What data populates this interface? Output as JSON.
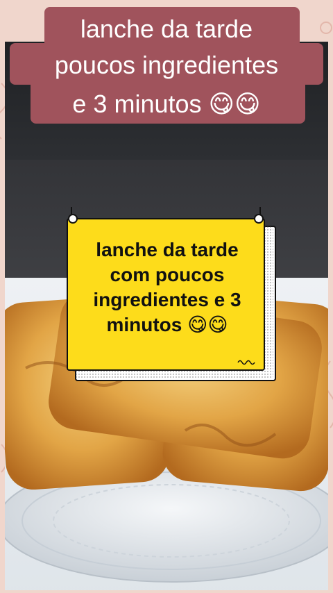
{
  "title": {
    "line1": "lanche da tarde",
    "line2": "poucos ingredientes",
    "line3": "e 3 minutos 😋😋"
  },
  "card": {
    "text": "lanche da tarde com poucos ingredientes e 3 minutos 😋😋"
  },
  "colors": {
    "title_bg": "#a0535c",
    "card_bg": "#fddc1b",
    "frame": "#f0d6cc"
  }
}
